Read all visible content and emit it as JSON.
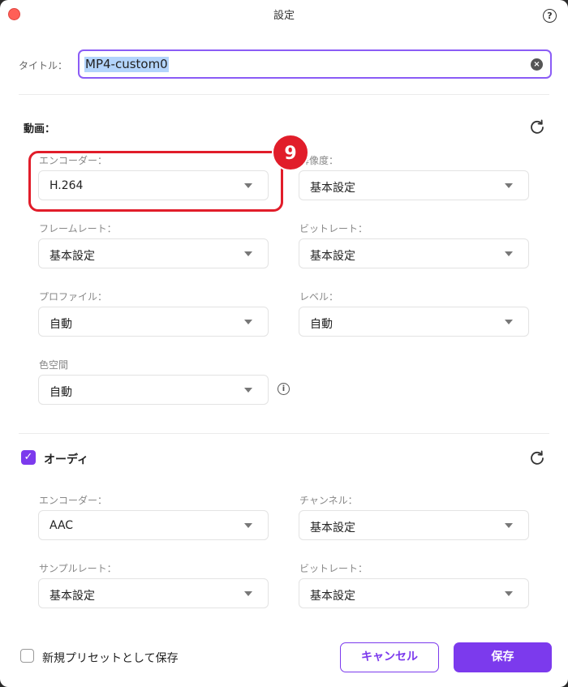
{
  "window": {
    "title": "設定",
    "help_glyph": "?"
  },
  "title_field": {
    "label": "タイトル：",
    "value": "MP4-custom0",
    "clear_glyph": "×"
  },
  "video": {
    "heading": "動画：",
    "encoder": {
      "label": "エンコーダー：",
      "value": "H.264"
    },
    "resolution": {
      "label": "解像度：",
      "value": "基本設定"
    },
    "frame_rate": {
      "label": "フレームレート：",
      "value": "基本設定"
    },
    "bit_rate": {
      "label": "ビットレート：",
      "value": "基本設定"
    },
    "profile": {
      "label": "プロファイル：",
      "value": "自動"
    },
    "level": {
      "label": "レベル：",
      "value": "自動"
    },
    "color_space": {
      "label": "色空間",
      "value": "自動",
      "info_glyph": "i"
    }
  },
  "audio": {
    "heading": "オーディ",
    "enabled": true,
    "check_glyph": "✓",
    "encoder": {
      "label": "エンコーダー：",
      "value": "AAC"
    },
    "channel": {
      "label": "チャンネル：",
      "value": "基本設定"
    },
    "sample_rate": {
      "label": "サンプルレート：",
      "value": "基本設定"
    },
    "bit_rate": {
      "label": "ビットレート：",
      "value": "基本設定"
    }
  },
  "footer": {
    "save_preset_label": "新規プリセットとして保存",
    "save_preset_checked": false,
    "cancel_label": "キャンセル",
    "save_label": "保存"
  },
  "annotation": {
    "step_number": "9",
    "color": "#e11d2a"
  },
  "colors": {
    "accent": "#7c3aed",
    "close_dot": "#ff5f57"
  }
}
